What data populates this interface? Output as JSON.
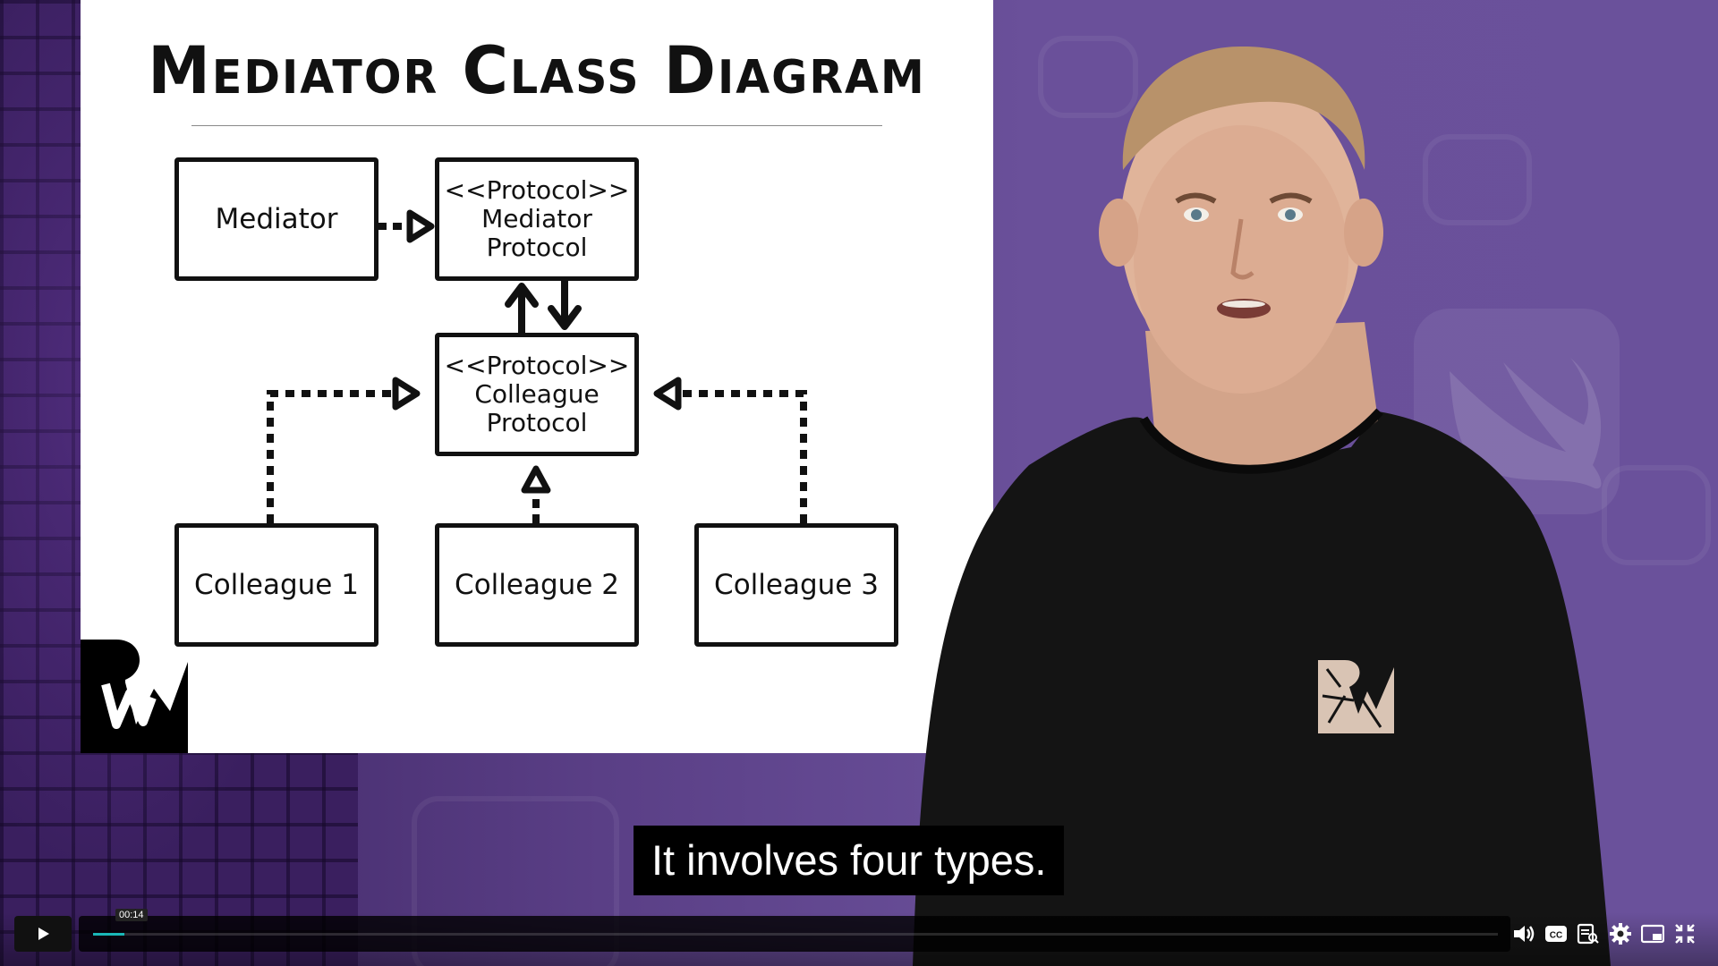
{
  "slide": {
    "title": "Mediator Class Diagram",
    "boxes": {
      "mediator": "Mediator",
      "mediator_protocol": [
        "<<Protocol>>",
        "Mediator",
        "Protocol"
      ],
      "colleague_protocol": [
        "<<Protocol>>",
        "Colleague",
        "Protocol"
      ],
      "colleague_1": "Colleague 1",
      "colleague_2": "Colleague 2",
      "colleague_3": "Colleague 3"
    }
  },
  "caption": {
    "text": "It involves four types."
  },
  "player": {
    "current_time": "00:14",
    "progress_fraction": 0.022,
    "accent_color": "#1ab7b7",
    "icons": [
      "play-icon",
      "volume-icon",
      "closed-captions-icon",
      "transcript-icon",
      "settings-icon",
      "picture-in-picture-icon",
      "exit-fullscreen-icon"
    ]
  },
  "colors": {
    "background_purple": "#5a3f86",
    "slide_bg": "#ffffff",
    "ink": "#111111"
  }
}
